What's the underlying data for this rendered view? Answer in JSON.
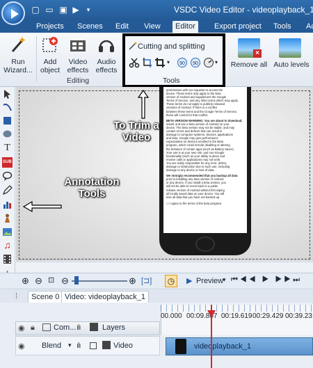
{
  "window": {
    "title": "VSDC Video Editor - videoplayback_1"
  },
  "menu": {
    "items": [
      "Projects",
      "Scenes",
      "Edit",
      "View",
      "Editor",
      "Export project",
      "Tools",
      "Ac"
    ],
    "active": "Editor"
  },
  "ribbon": {
    "run_wizard": "Run\nWizard...",
    "add_object": "Add\nobject",
    "video_effects": "Video\neffects",
    "audio_effects": "Audio\neffects",
    "editing_label": "Editing",
    "cutting_label": "Cutting and splitting",
    "tools_label": "Tools",
    "remove_all": "Remove all",
    "auto_levels": "Auto levels"
  },
  "annotations": {
    "trim": "To Trim a\nVideo",
    "tools": "Annotation\nTools"
  },
  "phone_screen": {
    "lines": [
      "permissions with our requests to access the",
      "device. These terms only apply to the beta",
      "version of Android and supplement the Google",
      "Terms of Service, and any other terms which may apply.",
      "These terms do not apply to publicly released",
      "versions of Android. If there is a conflict",
      "between these terms and the Google Terms of Service,",
      "these will control for that conflict.",
      "BETA VERSION WARNING: You are about to download,",
      "install, and use a beta version of Android on your",
      "device. The beta version may not be stable, and may",
      "contain errors and defects that can result in",
      "damage to computer systems, devices, applications",
      "and data. Google may give performance",
      "expectations on devices enrolled in the Beta",
      "program, which could include disabling or altering",
      "the behavior of certain apps (such as Battery Saver).",
      "Your use is at your own risk, and non-Google",
      "functionality (such as your ability to place and",
      "receive calls or applications may not work.",
      "You are solely responsible for any error, defect,",
      "damage or destruction due to such use, including",
      "damage to any device or loss of data.",
      "We strongly recommended that you backup all data",
      "prior to installing any beta version of Android",
      "or any device. If you install a beta version, you",
      "will not be able to revert back to a public",
      "release version of Android without first wiping",
      "all locally saved data on your device. You will",
      "lose all data that you have not backed up."
    ],
    "agree": "I agree to the terms of the beta program."
  },
  "playback": {
    "preview_label": "Preview"
  },
  "tabs": {
    "scene": "Scene 0",
    "video": "Video: videoplayback_1"
  },
  "timeline": {
    "col_composition": "Com...",
    "col_layers": "Layers",
    "blend": "Blend",
    "track_type": "Video",
    "clip_name": "videoplayback_1",
    "ticks": [
      "00.000",
      "00:09.807",
      "00:19.619",
      "00:29.429",
      "00:39.23"
    ]
  },
  "colors": {
    "title_bar": "#245a95",
    "accent_red": "#d0282a",
    "clip": "#5a92cc"
  }
}
